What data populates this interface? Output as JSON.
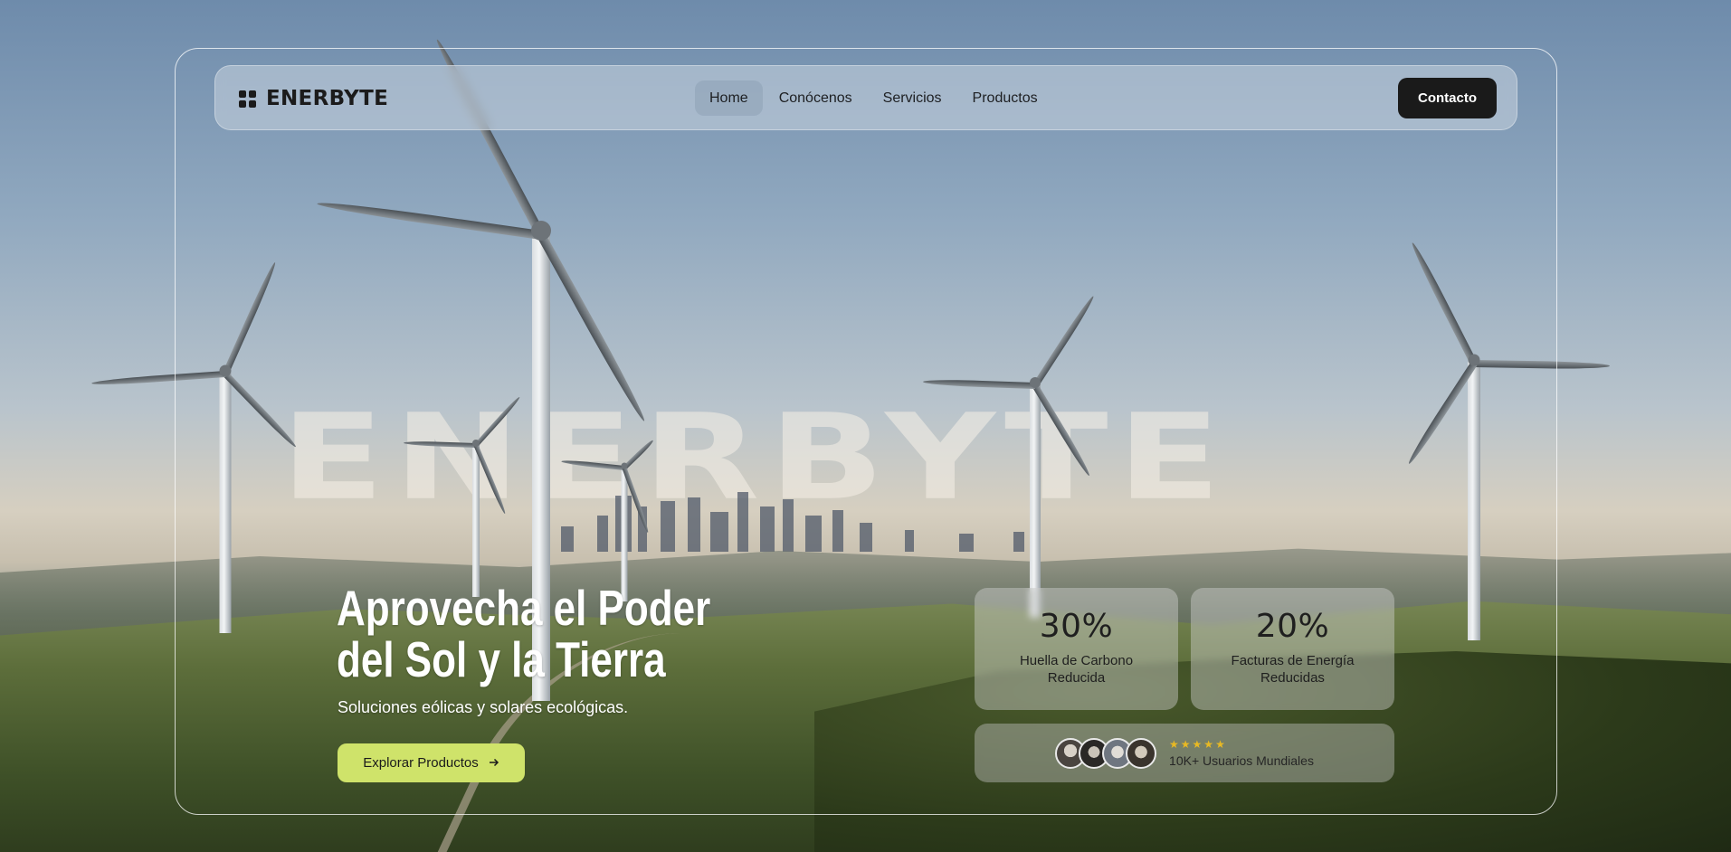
{
  "brand": {
    "name": "ENERBYTE",
    "icon": "grid-icon"
  },
  "nav": {
    "items": [
      {
        "label": "Home",
        "active": true
      },
      {
        "label": "Conócenos",
        "active": false
      },
      {
        "label": "Servicios",
        "active": false
      },
      {
        "label": "Productos",
        "active": false
      }
    ],
    "contact_label": "Contacto"
  },
  "watermark": "ENERBYTE",
  "hero": {
    "title_line1": "Aprovecha el Poder",
    "title_line2": "del Sol y la Tierra",
    "subtitle": "Soluciones eólicas y solares ecológicas.",
    "cta_label": "Explorar Productos",
    "cta_icon": "arrow-right-icon"
  },
  "stats": [
    {
      "value": "30%",
      "label_line1": "Huella de Carbono",
      "label_line2": "Reducida"
    },
    {
      "value": "20%",
      "label_line1": "Facturas de Energía",
      "label_line2": "Reducidas"
    }
  ],
  "users": {
    "rating": 5,
    "stars": "★★★★★",
    "label": "10K+ Usuarios Mundiales"
  },
  "colors": {
    "accent": "#cfe36a",
    "contact_bg": "#1a1a1a",
    "star": "#e8b923"
  }
}
